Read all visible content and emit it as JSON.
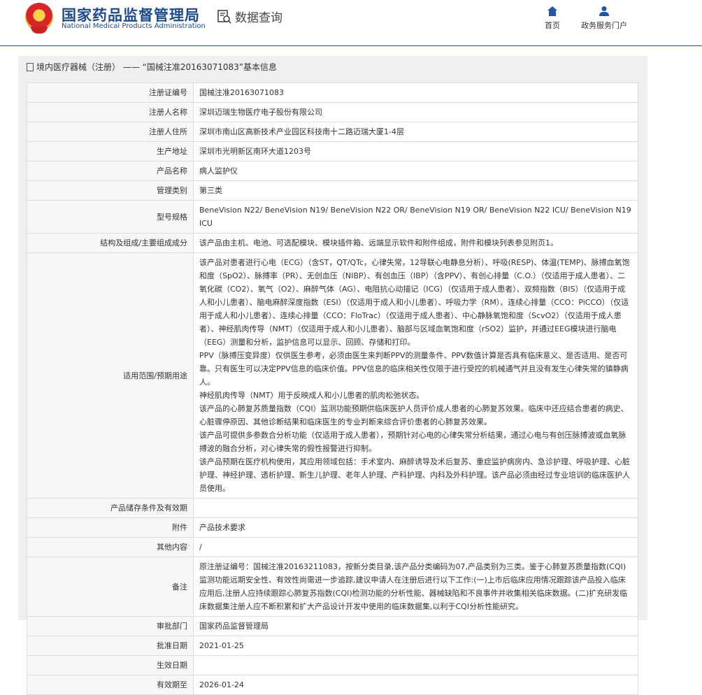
{
  "header": {
    "brand_cn": "国家药品监督管理局",
    "brand_en": "National Medical Products Administration",
    "query_label": "数据查询",
    "nav": [
      {
        "label": "首页",
        "icon": "home-icon"
      },
      {
        "label": "政务服务门户",
        "icon": "user-icon"
      }
    ]
  },
  "panel": {
    "title": "境内医疗器械（注册） —— “国械注准20163071083”基本信息"
  },
  "rows": [
    {
      "key": "注册证编号",
      "value": "国械注准20163071083"
    },
    {
      "key": "注册人名称",
      "value": "深圳迈瑞生物医疗电子股份有限公司"
    },
    {
      "key": "注册人住所",
      "value": "深圳市南山区高新技术产业园区科技南十二路迈瑞大厦1-4层"
    },
    {
      "key": "生产地址",
      "value": "深圳市光明新区南环大道1203号"
    },
    {
      "key": "产品名称",
      "value": "病人监护仪"
    },
    {
      "key": "管理类别",
      "value": "第三类"
    },
    {
      "key": "型号规格",
      "value": "BeneVision N22/ BeneVision N19/ BeneVision N22 OR/ BeneVision N19 OR/ BeneVision N22 ICU/ BeneVision N19 ICU"
    },
    {
      "key": "结构及组成/主要组成成分",
      "value": "该产品由主机、电池、可选配模块、模块插件箱、远端显示软件和附件组成，附件和模块列表参见附页1。"
    },
    {
      "key": "适用范围/预期用途",
      "value": "该产品对患者进行心电（ECG）（含ST，QT/QTc，心律失常，12导联心电静息分析）、呼吸(RESP)、体温(TEMP)、脉搏血氧饱和度（SpO2）、脉搏率（PR）、无创血压（NIBP）、有创血压（IBP）（含PPV）、有创心排量（C.O.）（仅适用于成人患者）、二氧化碳（CO2）、氧气（O2）、麻醉气体（AG）、电阻抗心动描记（ICG）（仅适用于成人患者）、双频指数（BIS）（仅适用于成人和小儿患者）、脑电麻醉深度指数（ESI）（仅适用于成人和小儿患者）、呼吸力学（RM）、连续心排量（CCO：PiCCO）（仅适用于成人和小儿患者）、连续心排量（CCO：FloTrac）（仅适用于成人患者）、中心静脉氧饱和度（ScvO2）（仅适用于成人患者）、神经肌肉传导（NMT）（仅适用于成人和小儿患者）、脑部与区域血氧饱和度（rSO2）监护，并通过EEG模块进行脑电（EEG）测量和分析，监护信息可以显示、回顾、存储和打印。\nPPV（脉搏压变异度）仅供医生参考，必须由医生来判断PPV的测量条件、PPV数值计算是否具有临床意义、是否适用、是否可靠。只有医生可以决定PPV信息的临床价值。PPV信息的临床相关性仅限于进行受控的机械通气并且没有发生心律失常的镇静病人。\n神经肌肉传导（NMT）用于反映成人和小儿患者的肌肉松弛状态。\n该产品的心肺复苏质量指数（CQI）监测功能预期供临床医护人员评价成人患者的心肺复苏效果。临床中还应结合患者的病史、心脏骤停原因、其他诊断结果和临床医生的专业判断来综合评价患者的心肺复苏效果。\n该产品可提供多参数合分析功能（仅适用于成人患者），预期针对心电的心律失常分析结果，通过心电与有创压脉搏波或血氧脉搏波的融合分析，对心律失常的假性报警进行抑制。\n该产品预期在医疗机构使用，其应用领域包括：手术室内、麻醉诱导及术后复苏、重症监护病房内、急诊护理、呼吸护理、心脏护理、神经护理、透析护理、新生儿护理、老年人护理、产科护理、内科及外科护理。该产品必须由经过专业培训的临床医护人员使用。"
    },
    {
      "key": "产品储存条件及有效期",
      "value": ""
    },
    {
      "key": "附件",
      "value": "产品技术要求"
    },
    {
      "key": "其他内容",
      "value": "/"
    },
    {
      "key": "备注",
      "value": "原注册证编号：国械注准20163211083，按新分类目录,该产品分类编码为07,产品类别为三类。鉴于心肺复苏质量指数(CQI)监测功能远期安全性、有效性尚需进一步追踪,建议申请人在注册后进行以下工作:(一)上市后临床应用情况跟踪该产品投入临床应用后,注册人应持续跟踪心肺复苏指数(CQI)检测功能的分析性能、器械缺陷和不良事件并收集相关临床数据。(二)扩充研发临床数据集注册人应不断积累和扩大产品设计开发中使用的临床数据集,以利于CQI分析性能研究。"
    },
    {
      "key": "审批部门",
      "value": "国家药品监督管理局"
    },
    {
      "key": "批准日期",
      "value": "2021-01-25"
    },
    {
      "key": "生效日期",
      "value": ""
    },
    {
      "key": "有效期至",
      "value": "2026-01-24"
    }
  ]
}
